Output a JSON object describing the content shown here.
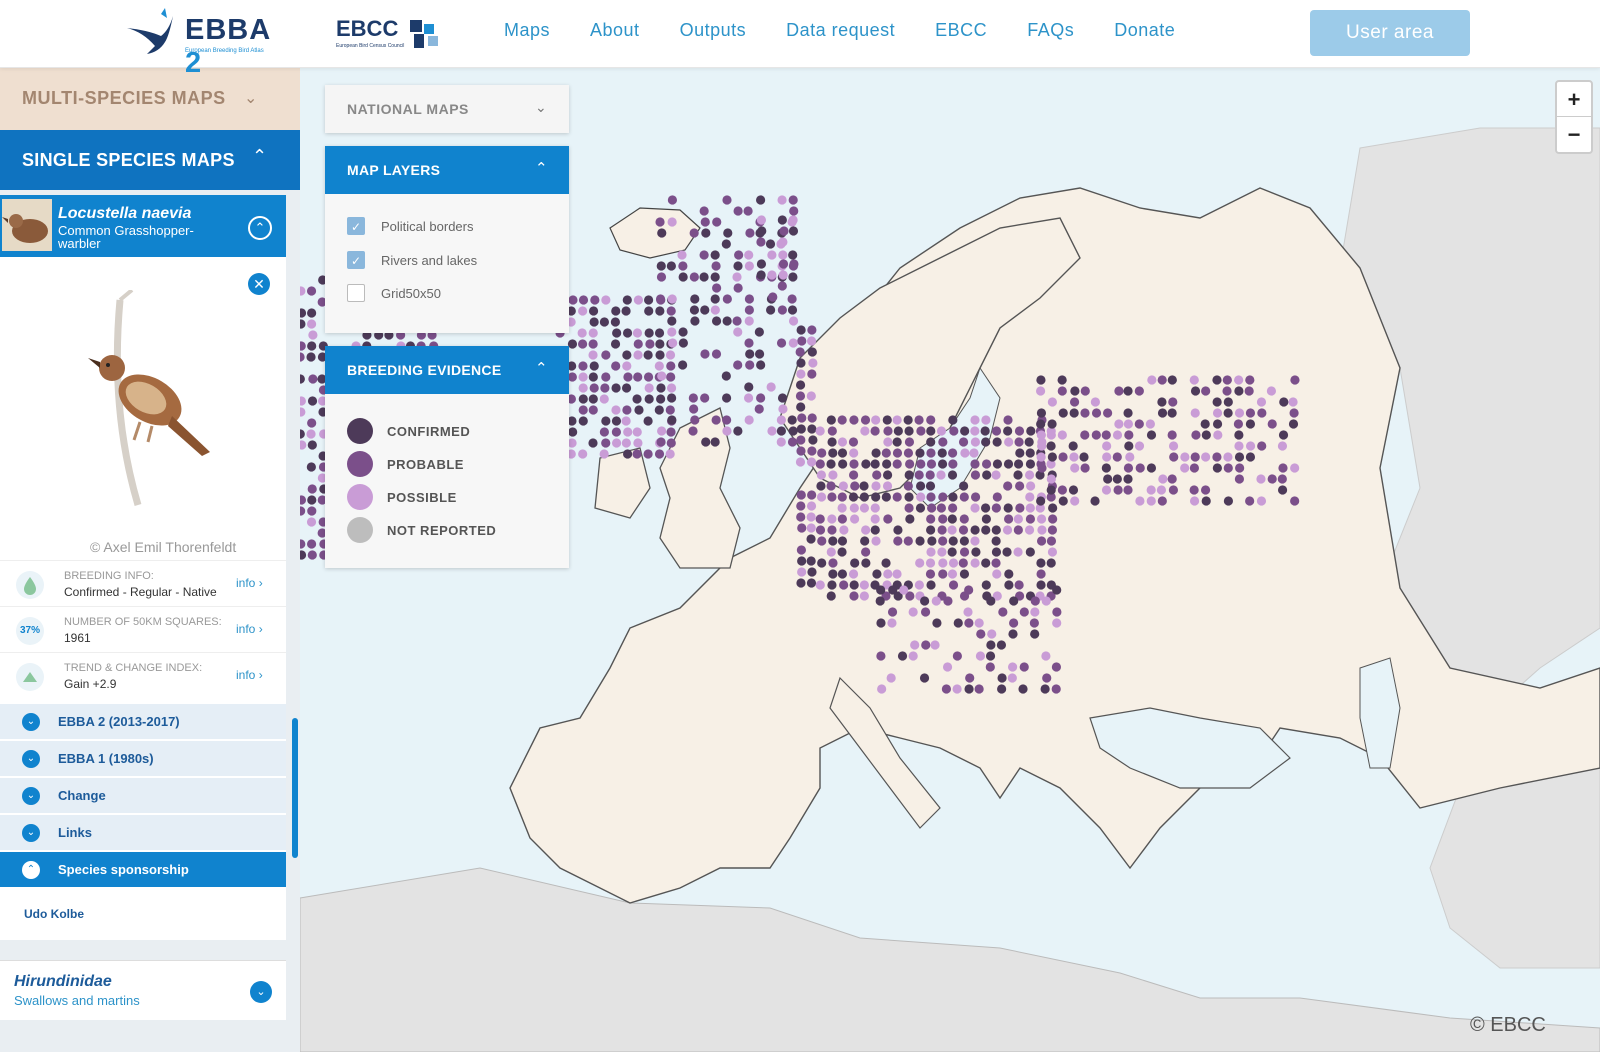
{
  "header": {
    "logo_main": "EBBA",
    "logo_num": "2",
    "logo_sub": "European Breeding Bird Atlas",
    "logo_partner": "EBCC",
    "logo_partner_sub": "European Bird Census Council",
    "nav": [
      "Maps",
      "About",
      "Outputs",
      "Data request",
      "EBCC",
      "FAQs",
      "Donate"
    ],
    "user_button": "User area"
  },
  "sidebar": {
    "multi_species": "MULTI-SPECIES MAPS",
    "single_species": "SINGLE SPECIES MAPS",
    "species": {
      "latin": "Locustella naevia",
      "common": "Common Grasshopper-warbler",
      "credit": "© Axel Emil Thorenfeldt"
    },
    "info_rows": [
      {
        "key": "BREEDING INFO:",
        "value": "Confirmed - Regular - Native",
        "link": "info",
        "icon": "drop-icon"
      },
      {
        "key": "NUMBER OF 50KM SQUARES:",
        "value": "1961",
        "link": "info",
        "badge": "37%"
      },
      {
        "key": "TREND & CHANGE INDEX:",
        "value": "Gain +2.9",
        "link": "info",
        "icon": "triangle-up-icon"
      }
    ],
    "sections": [
      {
        "label": "EBBA 2 (2013-2017)"
      },
      {
        "label": "EBBA 1 (1980s)"
      },
      {
        "label": "Change"
      },
      {
        "label": "Links"
      },
      {
        "label": "Species sponsorship"
      }
    ],
    "sponsor": "Udo Kolbe",
    "family": {
      "latin": "Hirundinidae",
      "common": "Swallows and martins"
    }
  },
  "map_controls": {
    "national_maps": "NATIONAL MAPS",
    "map_layers": {
      "title": "MAP LAYERS",
      "items": [
        {
          "label": "Political borders",
          "checked": true
        },
        {
          "label": "Rivers and lakes",
          "checked": true
        },
        {
          "label": "Grid50x50",
          "checked": false
        }
      ]
    },
    "breeding_evidence": {
      "title": "BREEDING EVIDENCE",
      "items": [
        {
          "label": "CONFIRMED",
          "color": "#4d3a59"
        },
        {
          "label": "PROBABLE",
          "color": "#7b4f8a"
        },
        {
          "label": "POSSIBLE",
          "color": "#c99cd6"
        },
        {
          "label": "NOT REPORTED",
          "color": "#bdbdbd"
        }
      ]
    },
    "zoom_in": "+",
    "zoom_out": "−",
    "copyright": "© EBCC"
  },
  "colors": {
    "primary": "#1083ce",
    "nav_link": "#2d93c9",
    "land": "#f7f0e6",
    "sea": "#e7f3f8",
    "non_atlas_land": "#e2e2e2"
  }
}
